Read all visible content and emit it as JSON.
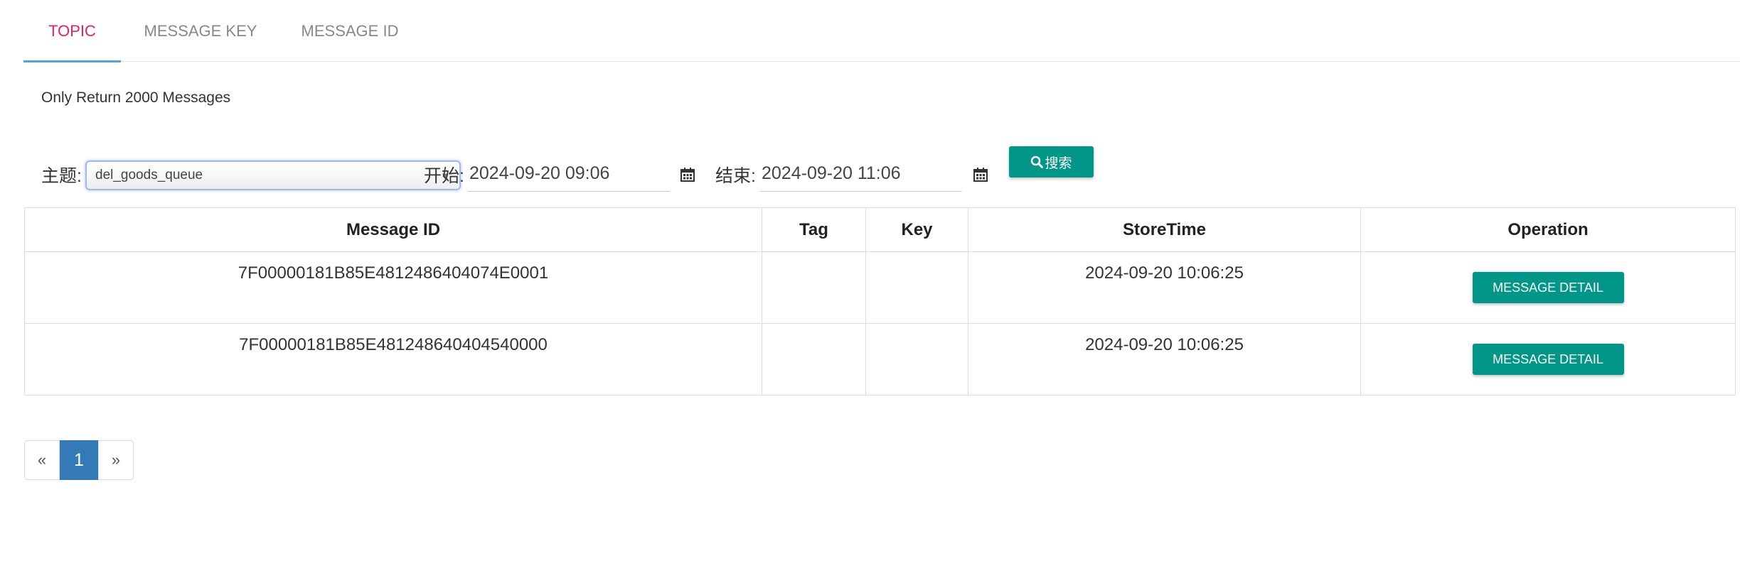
{
  "tabs": [
    {
      "label": "TOPIC",
      "active": true
    },
    {
      "label": "MESSAGE KEY",
      "active": false
    },
    {
      "label": "MESSAGE ID",
      "active": false
    }
  ],
  "info_text": "Only Return 2000 Messages",
  "filter": {
    "topic_label": "主题:",
    "topic_value": "del_goods_queue",
    "start_label": "开始:",
    "start_value": "2024-09-20 09:06",
    "end_label": "结束:",
    "end_value": "2024-09-20 11:06",
    "search_label": "搜索",
    "icons": {
      "search": "search-icon",
      "calendar": "calendar-icon",
      "dropdown": "chevron-down-icon"
    }
  },
  "table": {
    "headers": [
      "Message ID",
      "Tag",
      "Key",
      "StoreTime",
      "Operation"
    ],
    "rows": [
      {
        "id": "7F00000181B85E4812486404074E0001",
        "tag": "",
        "key": "",
        "store_time": "2024-09-20 10:06:25",
        "operation": "MESSAGE DETAIL"
      },
      {
        "id": "7F00000181B85E481248640404540000",
        "tag": "",
        "key": "",
        "store_time": "2024-09-20 10:06:25",
        "operation": "MESSAGE DETAIL"
      }
    ]
  },
  "pagination": {
    "prev": "«",
    "current": "1",
    "next": "»"
  },
  "colors": {
    "accent": "#009688",
    "active_tab": "#e91e63",
    "tab_underline": "#4fa3e0",
    "page_active": "#337ab7"
  }
}
